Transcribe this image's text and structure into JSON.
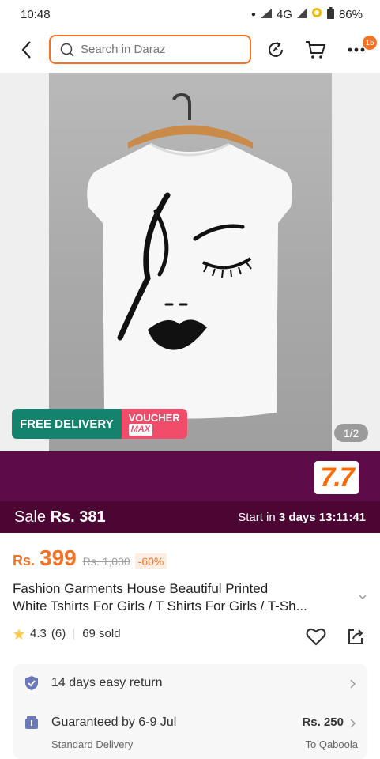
{
  "status_bar": {
    "time": "10:48",
    "network": "4G",
    "battery": "86%"
  },
  "header": {
    "search_placeholder": "Search in Daraz",
    "cart_badge": "15"
  },
  "gallery": {
    "free_delivery": "FREE DELIVERY",
    "voucher": "VOUCHER",
    "voucher_max": "MAX",
    "counter": "1/2"
  },
  "campaign": {
    "logo": "7.7",
    "sale_label": "Sale",
    "sale_price": "Rs. 381",
    "start_prefix": "Start in",
    "start_days": "3 days",
    "start_time": "13:11:41"
  },
  "price": {
    "currency": "Rs.",
    "amount": "399",
    "original": "Rs. 1,000",
    "discount": "-60%"
  },
  "product": {
    "title_line1": "Fashion Garments House Beautiful Printed",
    "title_line2": "White Tshirts For Girls / T Shirts For Girls / T-Sh..."
  },
  "rating": {
    "score": "4.3",
    "count": "(6)",
    "sold": "69 sold"
  },
  "services": {
    "return_label": "14 days easy return",
    "delivery_label": "Guaranteed by 6-9 Jul",
    "delivery_sub": "Standard Delivery",
    "delivery_fee": "Rs. 250",
    "delivery_to": "To Qaboola"
  },
  "colors": {
    "accent": "#f57224",
    "campaign": "#5e0b49",
    "free_delivery": "#14836d",
    "voucher": "#f14c69"
  }
}
